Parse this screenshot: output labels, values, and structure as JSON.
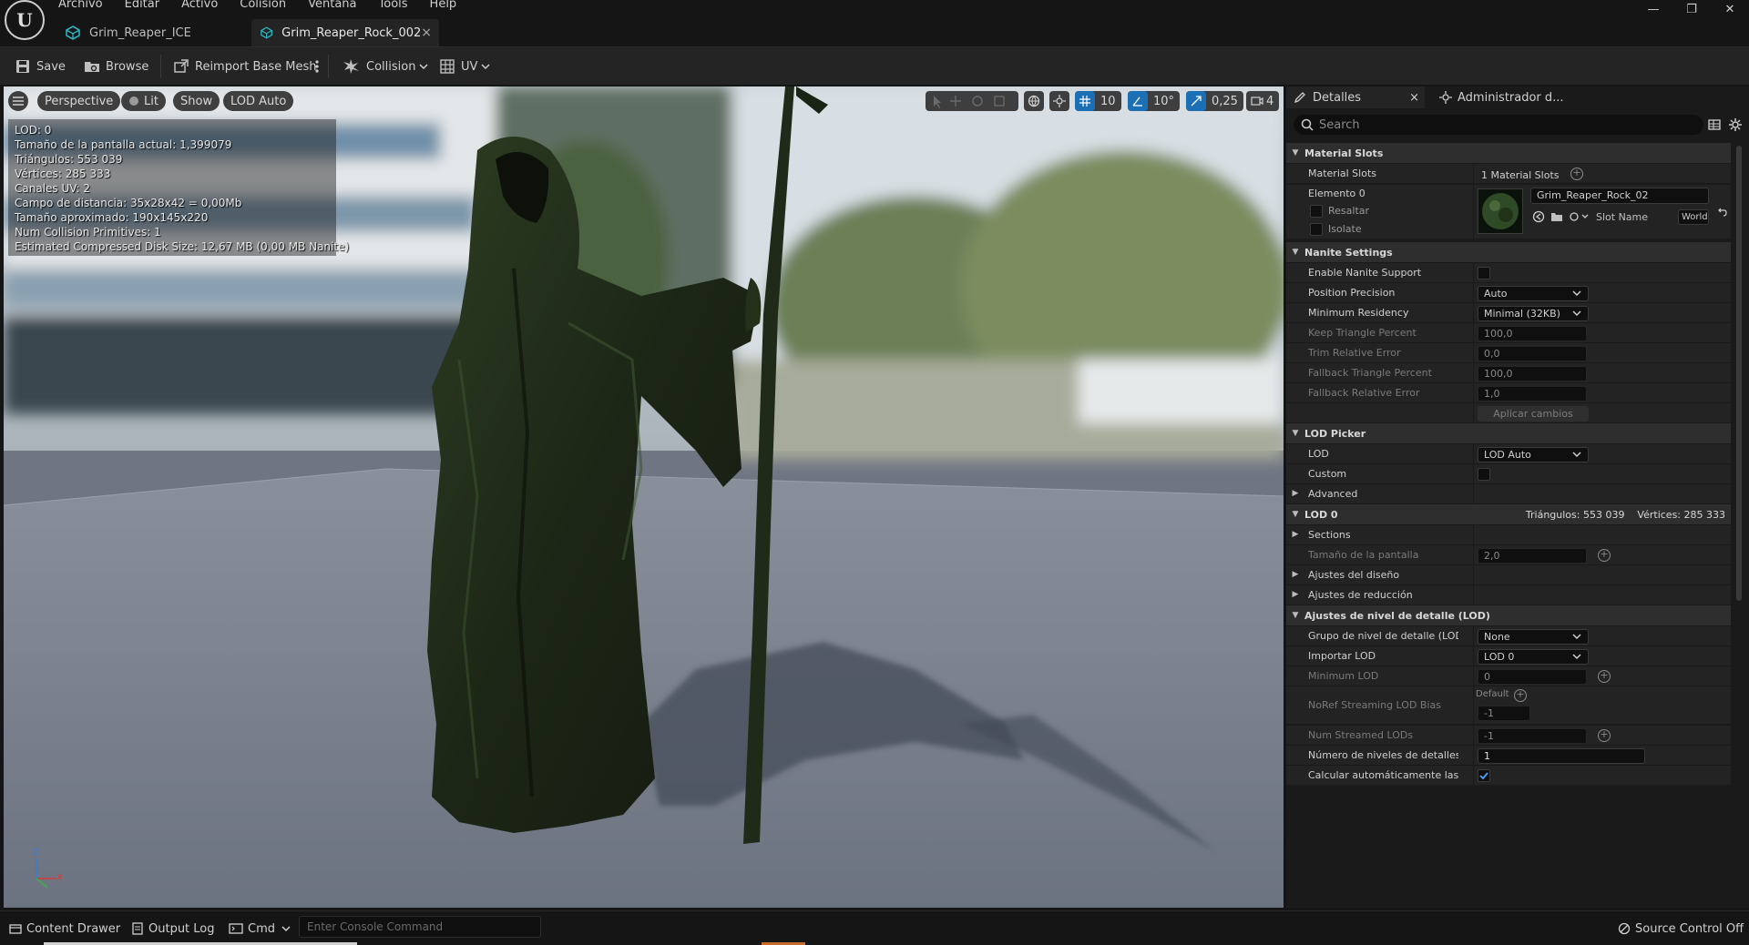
{
  "menu": [
    "Archivo",
    "Editar",
    "Activo",
    "Colisión",
    "Ventana",
    "Tools",
    "Help"
  ],
  "window_controls": [
    "—",
    "❐",
    "✕"
  ],
  "tabs": [
    {
      "label": "Grim_Reaper_ICE"
    },
    {
      "label": "Grim_Reaper_Rock_002",
      "close": "×"
    }
  ],
  "toolbar": {
    "save": "Save",
    "browse": "Browse",
    "reimport": "Reimport Base Mesh",
    "collision": "Collision",
    "uv": "UV"
  },
  "viewport": {
    "perspective": "Perspective",
    "lit": "Lit",
    "show": "Show",
    "lod": "LOD Auto",
    "stats": [
      "LOD:  0",
      "Tamaño de la pantalla actual: 1,399079",
      "Triángulos: 553 039",
      "Vértices: 285 333",
      "Canales UV: 2",
      "Campo de distancia:  35x28x42 = 0,00Mb",
      "Tamaño aproximado: 190x145x220",
      "Num Collision Primitives:  1",
      "Estimated Compressed Disk Size: 12,67 MB (0,00 MB Nanite)"
    ],
    "grid_snap": "10",
    "rotation_snap": "10°",
    "scale_snap": "0,25",
    "camera_speed": "4",
    "axis_labels": {
      "z": "Z",
      "x": "X"
    }
  },
  "details": {
    "tab_details": "Detalles",
    "tab_details_close": "×",
    "tab_admin": "Administrador d...",
    "search_placeholder": "Search",
    "material_slots": {
      "header": "Material Slots",
      "label": "Material Slots",
      "value": "1 Material Slots",
      "element": "Elemento 0",
      "highlight": "Resaltar",
      "isolate": "Isolate",
      "material_name": "Grim_Reaper_Rock_02",
      "slot_name_label": "Slot Name",
      "slot_name_value": "World"
    },
    "nanite": {
      "header": "Nanite Settings",
      "enable": "Enable Nanite Support",
      "position_precision": "Position Precision",
      "position_precision_value": "Auto",
      "min_residency": "Minimum Residency",
      "min_residency_value": "Minimal (32KB)",
      "keep_triangle": "Keep Triangle Percent",
      "keep_triangle_value": "100,0",
      "trim_error": "Trim Relative Error",
      "trim_error_value": "0,0",
      "fallback_triangle": "Fallback Triangle Percent",
      "fallback_triangle_value": "100,0",
      "fallback_error": "Fallback Relative Error",
      "fallback_error_value": "1,0",
      "apply": "Aplicar cambios"
    },
    "lod_picker": {
      "header": "LOD Picker",
      "lod": "LOD",
      "lod_value": "LOD Auto",
      "custom": "Custom",
      "advanced": "Advanced"
    },
    "lod0": {
      "header": "LOD 0",
      "summary": "Triángulos: 553 039    Vértices: 285 333",
      "sections": "Sections",
      "screen_size": "Tamaño de la pantalla",
      "screen_size_value": "2,0",
      "build_settings": "Ajustes del diseño",
      "reduction_settings": "Ajustes de reducción"
    },
    "lod_settings": {
      "header": "Ajustes de nivel de detalle (LOD)",
      "group": "Grupo de nivel de detalle (LOD)",
      "group_value": "None",
      "import_lod": "Importar LOD",
      "import_lod_value": "LOD 0",
      "min_lod": "Minimum LOD",
      "min_lod_value": "0",
      "noref_bias": "NoRef Streaming LOD Bias",
      "noref_default": "Default",
      "noref_value": "-1",
      "num_streamed": "Num Streamed LODs",
      "num_streamed_value": "-1",
      "num_lods": "Número de niveles de detalles (LO",
      "num_lods_value": "1",
      "auto_compute": "Calcular automáticamente las dist"
    }
  },
  "statusbar": {
    "content_drawer": "Content Drawer",
    "output_log": "Output Log",
    "cmd": "Cmd",
    "console_placeholder": "Enter Console Command",
    "source_control": "Source Control Off"
  },
  "colors": {
    "accent_blue": "#1b6fb5",
    "tab_icon_teal": "#2bb3c0",
    "panel_bg": "#1a1a1a",
    "header_bg": "#2e2e2e"
  }
}
